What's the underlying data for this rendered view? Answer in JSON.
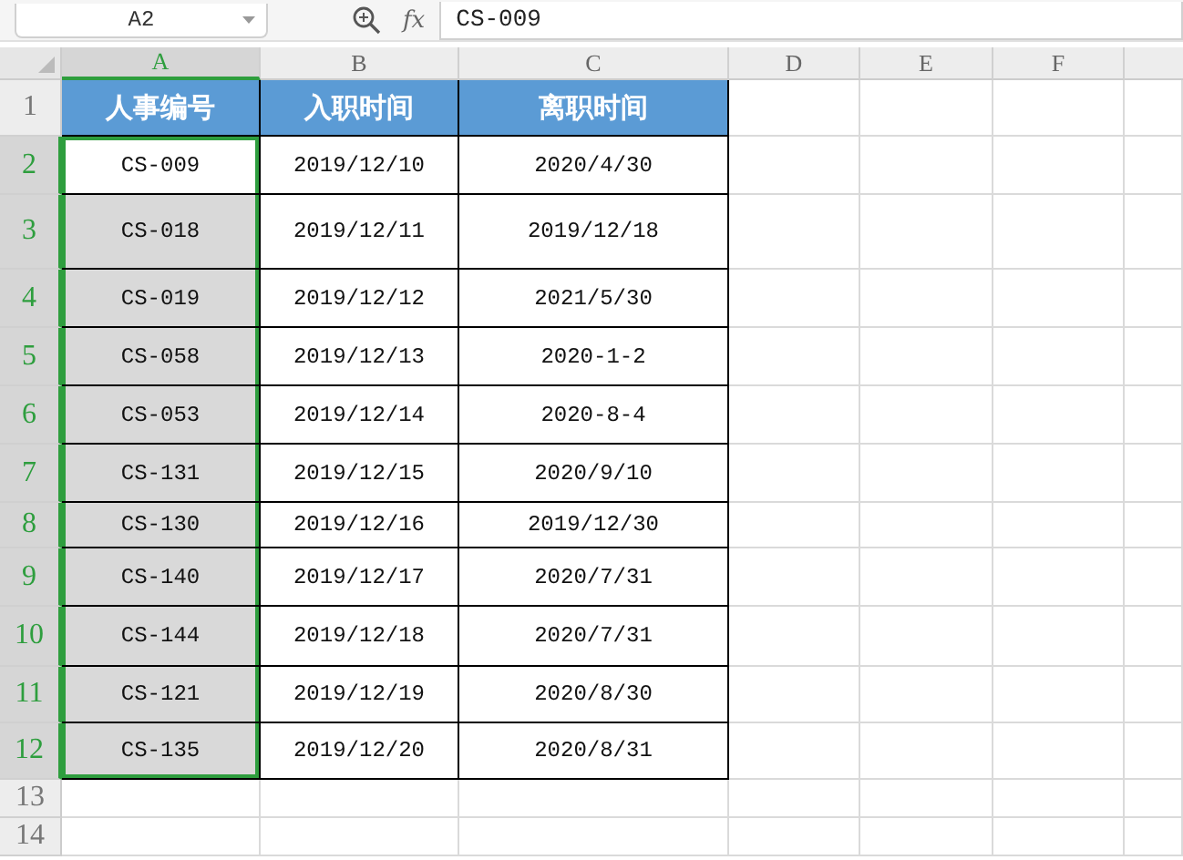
{
  "name_box": "A2",
  "function_label": "fx",
  "formula": "CS-009",
  "columns": [
    {
      "label": "A",
      "selected": true
    },
    {
      "label": "B",
      "selected": false
    },
    {
      "label": "C",
      "selected": false
    },
    {
      "label": "D",
      "selected": false
    },
    {
      "label": "E",
      "selected": false
    },
    {
      "label": "F",
      "selected": false
    }
  ],
  "header_row": {
    "number": "1",
    "cells": [
      "人事编号",
      "入职时间",
      "离职时间"
    ]
  },
  "rows": [
    {
      "number": "2",
      "selected": true,
      "active": true,
      "cells": [
        "CS-009",
        "2019/12/10",
        "2020/4/30"
      ]
    },
    {
      "number": "3",
      "selected": true,
      "active": false,
      "cells": [
        "CS-018",
        "2019/12/11",
        "2019/12/18"
      ]
    },
    {
      "number": "4",
      "selected": true,
      "active": false,
      "cells": [
        "CS-019",
        "2019/12/12",
        "2021/5/30"
      ]
    },
    {
      "number": "5",
      "selected": true,
      "active": false,
      "cells": [
        "CS-058",
        "2019/12/13",
        "2020-1-2"
      ]
    },
    {
      "number": "6",
      "selected": true,
      "active": false,
      "cells": [
        "CS-053",
        "2019/12/14",
        "2020-8-4"
      ]
    },
    {
      "number": "7",
      "selected": true,
      "active": false,
      "cells": [
        "CS-131",
        "2019/12/15",
        "2020/9/10"
      ]
    },
    {
      "number": "8",
      "selected": true,
      "active": false,
      "cells": [
        "CS-130",
        "2019/12/16",
        "2019/12/30"
      ]
    },
    {
      "number": "9",
      "selected": true,
      "active": false,
      "cells": [
        "CS-140",
        "2019/12/17",
        "2020/7/31"
      ]
    },
    {
      "number": "10",
      "selected": true,
      "active": false,
      "cells": [
        "CS-144",
        "2019/12/18",
        "2020/7/31"
      ]
    },
    {
      "number": "11",
      "selected": true,
      "active": false,
      "cells": [
        "CS-121",
        "2019/12/19",
        "2020/8/30"
      ]
    },
    {
      "number": "12",
      "selected": true,
      "active": false,
      "cells": [
        "CS-135",
        "2019/12/20",
        "2020/8/31"
      ]
    }
  ],
  "empty_rows": [
    "13",
    "14"
  ]
}
